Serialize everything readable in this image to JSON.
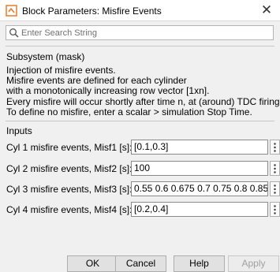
{
  "window": {
    "title": "Block Parameters: Misfire Events",
    "close_glyph": "✕"
  },
  "search": {
    "placeholder": "Enter Search String",
    "icon": "search-icon"
  },
  "subsystem": {
    "title": "Subsystem (mask)",
    "description": [
      "Injection of misfire events.",
      "Misfire events are defined for each cylinder",
      "with a monotonically increasing row vector [1xn].",
      "Every misfire will occur shortly after time n, at (around) TDC firing.",
      "To define no misfire, enter a scalar > simulation Stop Time."
    ]
  },
  "inputs": {
    "title": "Inputs",
    "params": [
      {
        "label": "Cyl 1 misfire events, Misf1 [s]:",
        "value": "[0.1,0.3]"
      },
      {
        "label": "Cyl 2 misfire events, Misf2 [s]:",
        "value": "100"
      },
      {
        "label": "Cyl 3 misfire events, Misf3 [s]:",
        "value": "0.55 0.6 0.675 0.7 0.75 0.8 0.85]"
      },
      {
        "label": "Cyl 4 misfire events, Misf4 [s]:",
        "value": "[0.2,0.4]"
      }
    ]
  },
  "buttons": {
    "ok": "OK",
    "cancel": "Cancel",
    "help": "Help",
    "apply": "Apply",
    "apply_enabled": false
  },
  "colors": {
    "window_bg": "#f0f0f0",
    "titlebar_bg": "#ffffff",
    "icon_orange": "#e97a2b",
    "disabled_text": "#a0a0a0"
  }
}
